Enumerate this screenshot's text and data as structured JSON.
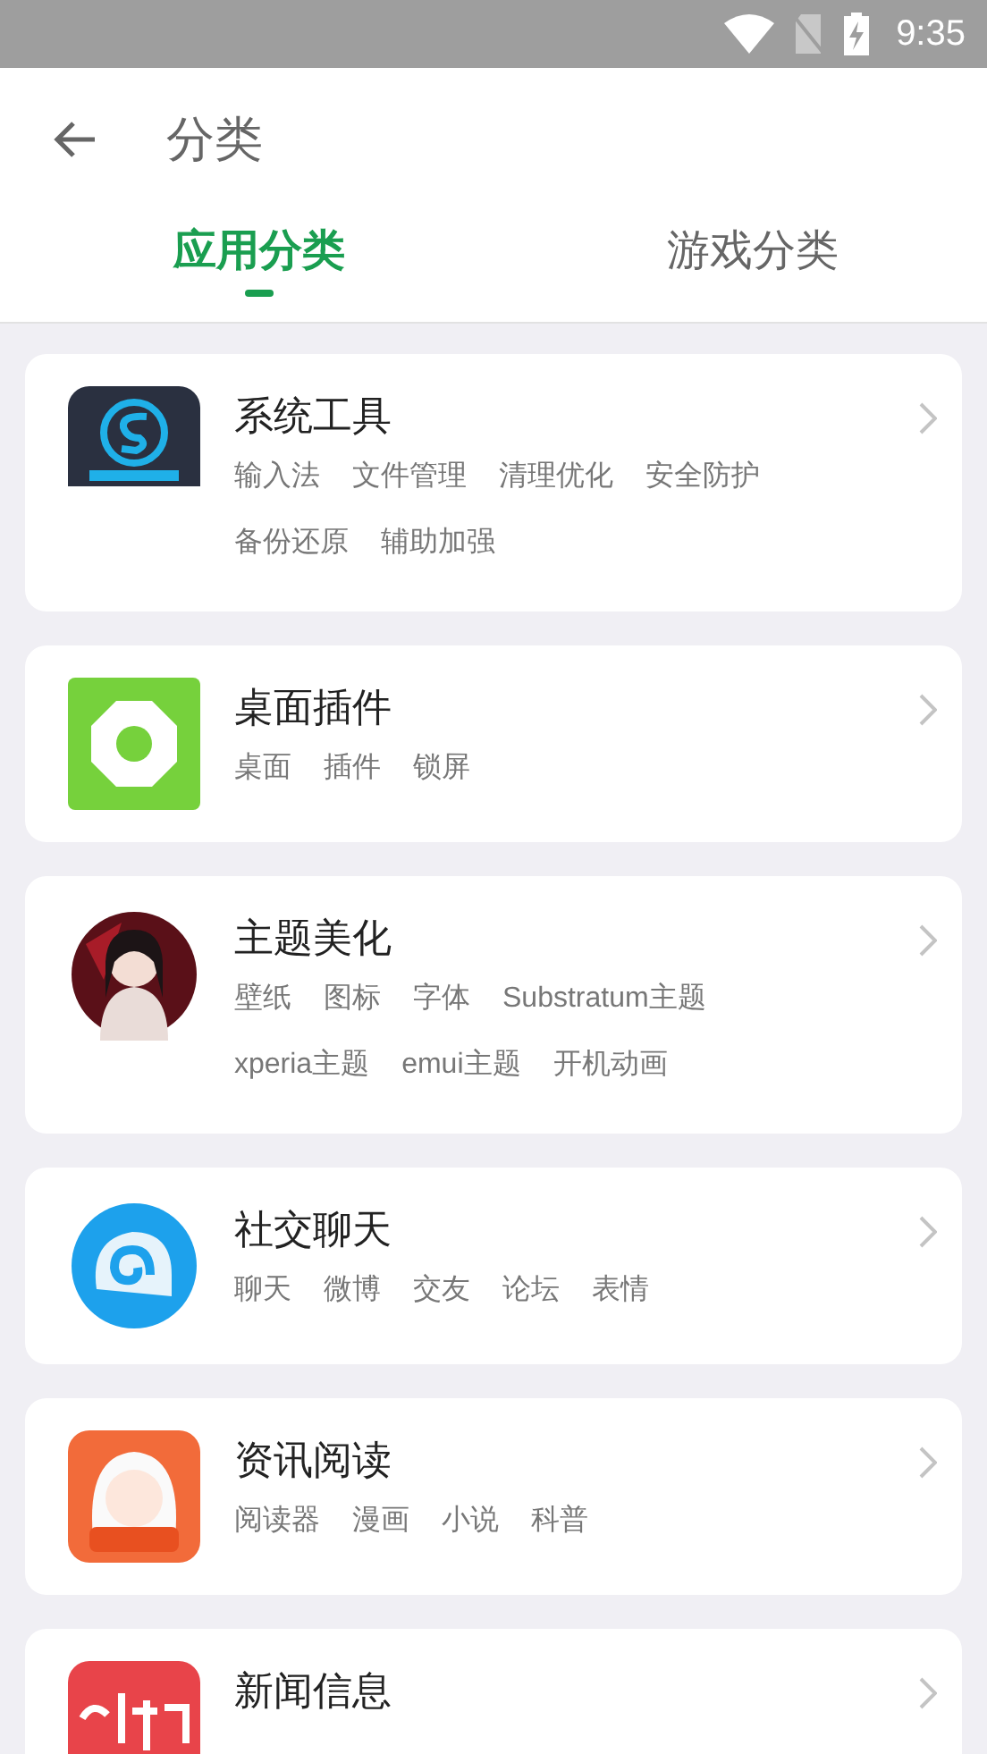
{
  "status_bar": {
    "time": "9:35"
  },
  "header": {
    "title": "分类"
  },
  "tabs": [
    {
      "label": "应用分类",
      "selected": true
    },
    {
      "label": "游戏分类",
      "selected": false
    }
  ],
  "categories": [
    {
      "title": "系统工具",
      "tags": [
        "输入法",
        "文件管理",
        "清理优化",
        "安全防护",
        "备份还原",
        "辅助加强"
      ]
    },
    {
      "title": "桌面插件",
      "tags": [
        "桌面",
        "插件",
        "锁屏"
      ]
    },
    {
      "title": "主题美化",
      "tags": [
        "壁纸",
        "图标",
        "字体",
        "Substratum主题",
        "xperia主题",
        "emui主题",
        "开机动画"
      ]
    },
    {
      "title": "社交聊天",
      "tags": [
        "聊天",
        "微博",
        "交友",
        "论坛",
        "表情"
      ]
    },
    {
      "title": "资讯阅读",
      "tags": [
        "阅读器",
        "漫画",
        "小说",
        "科普"
      ]
    },
    {
      "title": "新闻信息"
    }
  ]
}
